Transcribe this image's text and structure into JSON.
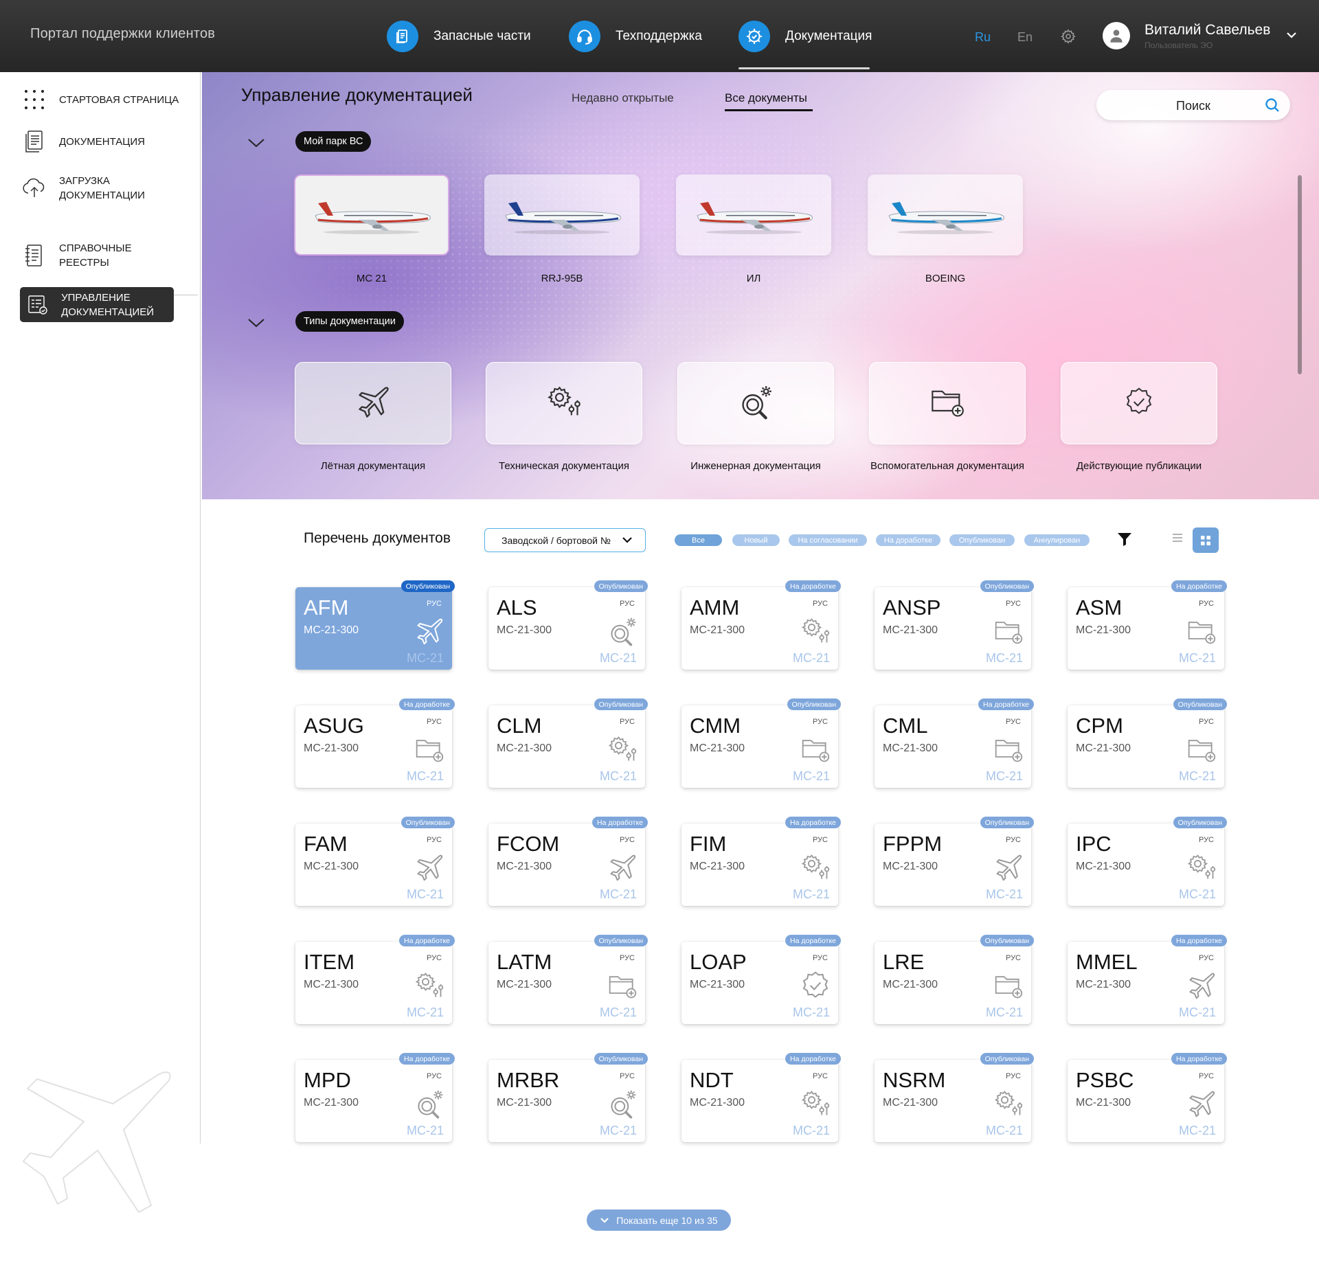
{
  "header": {
    "portal_title": "Портал поддержки клиентов",
    "nav": [
      {
        "label": "Запасные части",
        "icon": "document-icon"
      },
      {
        "label": "Техподдержка",
        "icon": "headset-icon"
      },
      {
        "label": "Документация",
        "icon": "gear-check-icon",
        "active": true
      }
    ],
    "lang_ru": "Ru",
    "lang_en": "En",
    "user_name": "Виталий Савельев",
    "user_role": "Пользователь ЭО"
  },
  "sidebar": {
    "items": [
      {
        "label": "Стартовая страница",
        "icon": "grid-dots-icon"
      },
      {
        "label": "Документация",
        "icon": "document-list-icon"
      },
      {
        "label": "Загрузка документации",
        "icon": "cloud-upload-icon"
      },
      {
        "label": "Справочные реестры",
        "icon": "registry-icon"
      },
      {
        "label": "Управление документацией",
        "icon": "doc-manage-icon",
        "active": true
      }
    ]
  },
  "hero": {
    "title": "Управление документацией",
    "tab_recent": "Недавно открытые",
    "tab_all": "Все документы",
    "search_placeholder": "Поиск",
    "fleet_pill": "Мой парк ВС",
    "aircraft": [
      {
        "label": "МС 21",
        "livery": "#c0392b"
      },
      {
        "label": "RRJ-95B",
        "livery": "#1f3f8f"
      },
      {
        "label": "ИЛ",
        "livery": "#c0392b"
      },
      {
        "label": "BOEING",
        "livery": "#1b86c8"
      }
    ],
    "doctypes_pill": "Типы документации",
    "doc_types": [
      {
        "label": "Лётная документация",
        "icon": "plane-icon"
      },
      {
        "label": "Техническая документация",
        "icon": "gear-sliders-icon"
      },
      {
        "label": "Инженерная документация",
        "icon": "gear-search-icon"
      },
      {
        "label": "Вспомогательная документация",
        "icon": "folder-plus-icon"
      },
      {
        "label": "Действующие публикации",
        "icon": "check-badge-icon"
      }
    ]
  },
  "docs": {
    "title": "Перечень документов",
    "serial_select": "Заводской / бортовой №",
    "status_chips": [
      {
        "label": "Все",
        "color": "#6fa3d9"
      },
      {
        "label": "Новый",
        "color": "#a9c7ec"
      },
      {
        "label": "На согласовании",
        "color": "#a9c7ec"
      },
      {
        "label": "На доработке",
        "color": "#a9c7ec"
      },
      {
        "label": "Опубликован",
        "color": "#a9c7ec"
      },
      {
        "label": "Аннулирован",
        "color": "#a9c7ec"
      }
    ],
    "status_colors": {
      "published": "#7ea6db",
      "published_selected": "#1f67c6",
      "rework": "#7ea6db"
    },
    "cards": [
      {
        "code": "AFM",
        "model": "МС-21-300",
        "lang": "РУС",
        "family": "МС-21",
        "status": "Опубликован",
        "icon": "plane",
        "selected": true
      },
      {
        "code": "ALS",
        "model": "МС-21-300",
        "lang": "РУС",
        "family": "МС-21",
        "status": "Опубликован",
        "icon": "gearsearch"
      },
      {
        "code": "AMM",
        "model": "МС-21-300",
        "lang": "РУС",
        "family": "МС-21",
        "status": "На доработке",
        "icon": "gearslider"
      },
      {
        "code": "ANSP",
        "model": "МС-21-300",
        "lang": "РУС",
        "family": "МС-21",
        "status": "Опубликован",
        "icon": "folder"
      },
      {
        "code": "ASM",
        "model": "МС-21-300",
        "lang": "РУС",
        "family": "МС-21",
        "status": "На доработке",
        "icon": "folder"
      },
      {
        "code": "ASUG",
        "model": "МС-21-300",
        "lang": "РУС",
        "family": "МС-21",
        "status": "На доработке",
        "icon": "folder"
      },
      {
        "code": "CLM",
        "model": "МС-21-300",
        "lang": "РУС",
        "family": "МС-21",
        "status": "Опубликован",
        "icon": "gearslider"
      },
      {
        "code": "CMM",
        "model": "МС-21-300",
        "lang": "РУС",
        "family": "МС-21",
        "status": "Опубликован",
        "icon": "folder"
      },
      {
        "code": "CML",
        "model": "МС-21-300",
        "lang": "РУС",
        "family": "МС-21",
        "status": "На доработке",
        "icon": "folder"
      },
      {
        "code": "CPM",
        "model": "МС-21-300",
        "lang": "РУС",
        "family": "МС-21",
        "status": "Опубликован",
        "icon": "folder"
      },
      {
        "code": "FAM",
        "model": "МС-21-300",
        "lang": "РУС",
        "family": "МС-21",
        "status": "Опубликован",
        "icon": "plane"
      },
      {
        "code": "FCOM",
        "model": "МС-21-300",
        "lang": "РУС",
        "family": "МС-21",
        "status": "На доработке",
        "icon": "plane"
      },
      {
        "code": "FIM",
        "model": "МС-21-300",
        "lang": "РУС",
        "family": "МС-21",
        "status": "На доработке",
        "icon": "gearslider"
      },
      {
        "code": "FPPM",
        "model": "МС-21-300",
        "lang": "РУС",
        "family": "МС-21",
        "status": "Опубликован",
        "icon": "plane"
      },
      {
        "code": "IPC",
        "model": "МС-21-300",
        "lang": "РУС",
        "family": "МС-21",
        "status": "Опубликован",
        "icon": "gearslider"
      },
      {
        "code": "ITEM",
        "model": "МС-21-300",
        "lang": "РУС",
        "family": "МС-21",
        "status": "На доработке",
        "icon": "gearslider"
      },
      {
        "code": "LATM",
        "model": "МС-21-300",
        "lang": "РУС",
        "family": "МС-21",
        "status": "Опубликован",
        "icon": "folder"
      },
      {
        "code": "LOAP",
        "model": "МС-21-300",
        "lang": "РУС",
        "family": "МС-21",
        "status": "На доработке",
        "icon": "check"
      },
      {
        "code": "LRE",
        "model": "МС-21-300",
        "lang": "РУС",
        "family": "МС-21",
        "status": "Опубликован",
        "icon": "folder"
      },
      {
        "code": "MMEL",
        "model": "МС-21-300",
        "lang": "РУС",
        "family": "МС-21",
        "status": "На доработке",
        "icon": "plane"
      },
      {
        "code": "MPD",
        "model": "МС-21-300",
        "lang": "РУС",
        "family": "МС-21",
        "status": "На доработке",
        "icon": "gearsearch"
      },
      {
        "code": "MRBR",
        "model": "МС-21-300",
        "lang": "РУС",
        "family": "МС-21",
        "status": "Опубликован",
        "icon": "gearsearch"
      },
      {
        "code": "NDT",
        "model": "МС-21-300",
        "lang": "РУС",
        "family": "МС-21",
        "status": "На доработке",
        "icon": "gearslider"
      },
      {
        "code": "NSRM",
        "model": "МС-21-300",
        "lang": "РУС",
        "family": "МС-21",
        "status": "Опубликован",
        "icon": "gearslider"
      },
      {
        "code": "PSBC",
        "model": "МС-21-300",
        "lang": "РУС",
        "family": "МС-21",
        "status": "На доработке",
        "icon": "plane"
      }
    ],
    "show_more": "Показать еще 10 из 35"
  }
}
